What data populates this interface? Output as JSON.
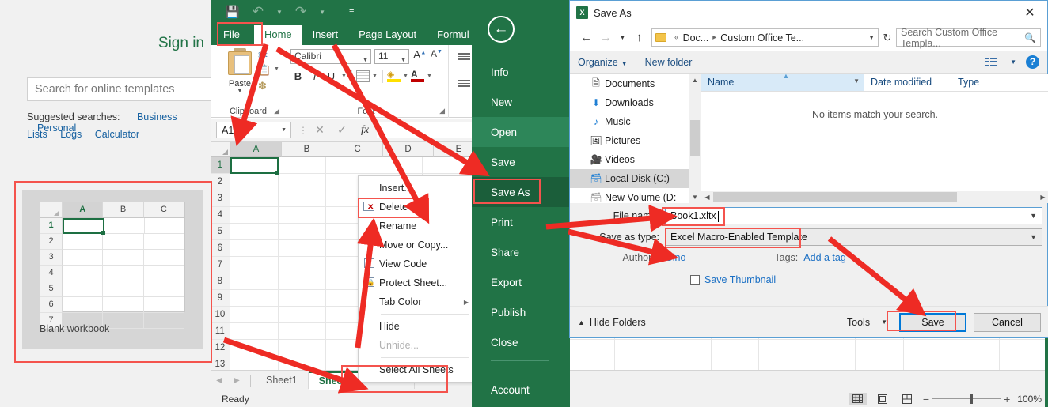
{
  "start_screen": {
    "sign_in": "Sign in",
    "search_placeholder": "Search for online templates",
    "suggested_label": "Suggested searches:",
    "suggested": [
      "Business",
      "Personal",
      "Lists",
      "Logs",
      "Calculator"
    ],
    "template_caption": "Blank workbook",
    "template_columns": [
      "A",
      "B",
      "C"
    ],
    "template_rows": [
      "1",
      "2",
      "3",
      "4",
      "5",
      "6",
      "7"
    ]
  },
  "excel": {
    "qat": {
      "save_icon": "save-icon",
      "undo_icon": "undo-icon",
      "redo_icon": "redo-icon",
      "customize_icon": "customize-qat-icon"
    },
    "tabs": [
      {
        "label": "File",
        "state": "file"
      },
      {
        "label": "Home",
        "state": "active"
      },
      {
        "label": "Insert",
        "state": "normal"
      },
      {
        "label": "Page Layout",
        "state": "normal"
      },
      {
        "label": "Formul",
        "state": "normal"
      }
    ],
    "ribbon": {
      "clipboard_group": "Clipboard",
      "paste_label": "Paste",
      "cut_icon": "scissors-icon",
      "copy_icon": "copy-icon",
      "format_painter_icon": "format-painter-icon",
      "font_group": "Font",
      "font_name": "Calibri",
      "font_size": "11",
      "grow_font_label": "A",
      "shrink_font_label": "A",
      "bold_label": "B",
      "italic_label": "I",
      "underline_label": "U",
      "borders_icon": "borders-icon",
      "fill_color_icon": "fill-color-icon",
      "font_color_label": "A"
    },
    "formula_bar": {
      "name_box": "A1",
      "cancel_icon": "cancel-icon",
      "enter_icon": "confirm-check-icon",
      "function_icon": "fx-icon",
      "formula_value": ""
    },
    "grid": {
      "columns": [
        "A",
        "B",
        "C",
        "D",
        "E"
      ],
      "rows": [
        "1",
        "2",
        "3",
        "4",
        "5",
        "6",
        "7",
        "8",
        "9",
        "10",
        "11",
        "12",
        "13"
      ],
      "active_cell": "A1"
    },
    "sheet_tabs": [
      {
        "label": "Sheet1",
        "active": false
      },
      {
        "label": "Sheet2",
        "active": true
      },
      {
        "label": "Sheet3",
        "active": false
      }
    ],
    "status": {
      "text": "Ready",
      "normal_view_icon": "normal-view-icon",
      "page_layout_icon": "page-layout-icon",
      "page_break_icon": "page-break-preview-icon",
      "zoom_out": "−",
      "zoom_in": "+",
      "zoom_level": "100%"
    }
  },
  "context_menu": {
    "items": [
      {
        "label": "Insert...",
        "accel": "I",
        "icon": "",
        "disabled": false,
        "arrow": false
      },
      {
        "label": "Delete",
        "accel": "D",
        "icon": "sheet-delete-icon",
        "disabled": false,
        "arrow": false
      },
      {
        "label": "Rename",
        "accel": "R",
        "icon": "",
        "disabled": false,
        "arrow": false
      },
      {
        "label": "Move or Copy...",
        "accel": "M",
        "icon": "",
        "disabled": false,
        "arrow": false
      },
      {
        "label": "View Code",
        "accel": "V",
        "icon": "view-code-icon",
        "disabled": false,
        "arrow": false
      },
      {
        "label": "Protect Sheet...",
        "accel": "P",
        "icon": "protect-sheet-icon",
        "disabled": false,
        "arrow": false
      },
      {
        "label": "Tab Color",
        "accel": "T",
        "icon": "",
        "disabled": false,
        "arrow": true
      },
      {
        "label": "Hide",
        "accel": "H",
        "icon": "",
        "disabled": false,
        "arrow": false,
        "sep_before": true
      },
      {
        "label": "Unhide...",
        "accel": "U",
        "icon": "",
        "disabled": true,
        "arrow": false
      },
      {
        "label": "Select All Sheets",
        "accel": "S",
        "icon": "",
        "disabled": false,
        "arrow": false,
        "sep_before": true
      }
    ]
  },
  "backstage": {
    "back_icon": "back-arrow-icon",
    "items": [
      {
        "label": "Info",
        "state": "normal"
      },
      {
        "label": "New",
        "state": "normal"
      },
      {
        "label": "Open",
        "state": "hover"
      },
      {
        "label": "Save",
        "state": "normal"
      },
      {
        "label": "Save As",
        "state": "selected"
      },
      {
        "label": "Print",
        "state": "normal"
      },
      {
        "label": "Share",
        "state": "normal"
      },
      {
        "label": "Export",
        "state": "normal"
      },
      {
        "label": "Publish",
        "state": "normal"
      },
      {
        "label": "Close",
        "state": "normal"
      },
      {
        "label": "Account",
        "state": "normal"
      }
    ]
  },
  "save_dialog": {
    "title": "Save As",
    "app_icon": "excel-icon",
    "close_icon": "close-icon",
    "nav": {
      "back_icon": "back-icon",
      "forward_icon": "forward-icon",
      "recent_icon": "recent-locations-icon",
      "up_icon": "up-one-level-icon",
      "folder_icon": "folder-icon",
      "breadcrumb": [
        "Doc...",
        "Custom Office Te..."
      ],
      "breadcrumb_prefix": "«",
      "dropdown_icon": "chevron-down-icon",
      "refresh_icon": "refresh-icon",
      "search_placeholder": "Search Custom Office Templa...",
      "search_icon": "search-icon"
    },
    "toolbar": {
      "organize": "Organize",
      "new_folder": "New folder",
      "view_icon": "view-options-icon",
      "help_icon": "help-icon"
    },
    "nav_pane": [
      {
        "label": "Documents",
        "icon": "documents-icon",
        "selected": false
      },
      {
        "label": "Downloads",
        "icon": "downloads-icon",
        "selected": false
      },
      {
        "label": "Music",
        "icon": "music-icon",
        "selected": false
      },
      {
        "label": "Pictures",
        "icon": "pictures-icon",
        "selected": false
      },
      {
        "label": "Videos",
        "icon": "videos-icon",
        "selected": false
      },
      {
        "label": "Local Disk (C:)",
        "icon": "drive-icon",
        "selected": true
      },
      {
        "label": "New Volume (D:",
        "icon": "drive-icon",
        "selected": false
      }
    ],
    "file_list": {
      "columns": [
        "Name",
        "Date modified",
        "Type"
      ],
      "empty_message": "No items match your search."
    },
    "fields": {
      "file_name_label": "File name:",
      "file_name_value": "Book1.xltx",
      "save_type_label": "Save as type:",
      "save_type_value": "Excel Macro-Enabled Template",
      "authors_label": "Authors:",
      "authors_value": "Gino",
      "tags_label": "Tags:",
      "tags_value": "Add a tag",
      "thumbnail_label": "Save Thumbnail"
    },
    "footer": {
      "hide_folders": "Hide Folders",
      "tools": "Tools",
      "save": "Save",
      "cancel": "Cancel"
    }
  },
  "annotations": {
    "highlight_color": "#f4534d",
    "boxes": [
      "blank-workbook-template",
      "file-tab",
      "delete-menu-item",
      "save-as-backstage",
      "file-name-field",
      "save-as-type-field",
      "save-button",
      "sheet2-tab"
    ]
  }
}
